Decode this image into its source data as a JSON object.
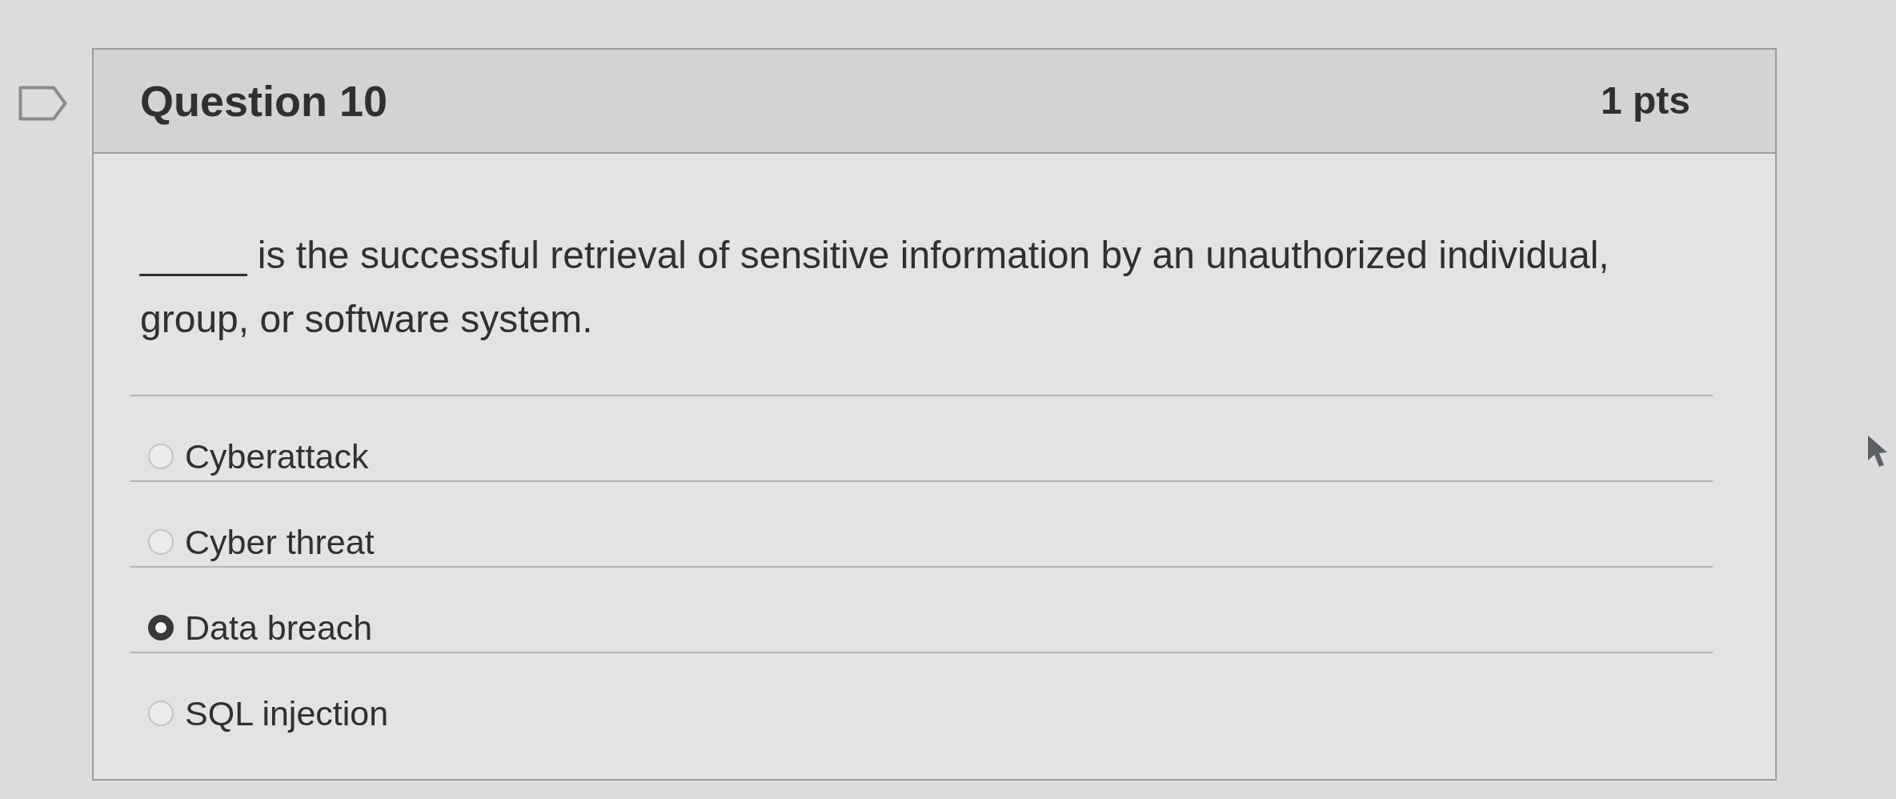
{
  "question": {
    "flagged": false,
    "title": "Question 10",
    "points": "1 pts",
    "prompt": "_____ is the successful retrieval of sensitive information by an unauthorized individual, group, or software system.",
    "options": [
      {
        "label": "Cyberattack",
        "selected": false
      },
      {
        "label": "Cyber threat",
        "selected": false
      },
      {
        "label": "Data breach",
        "selected": true
      },
      {
        "label": "SQL injection",
        "selected": false
      }
    ]
  }
}
